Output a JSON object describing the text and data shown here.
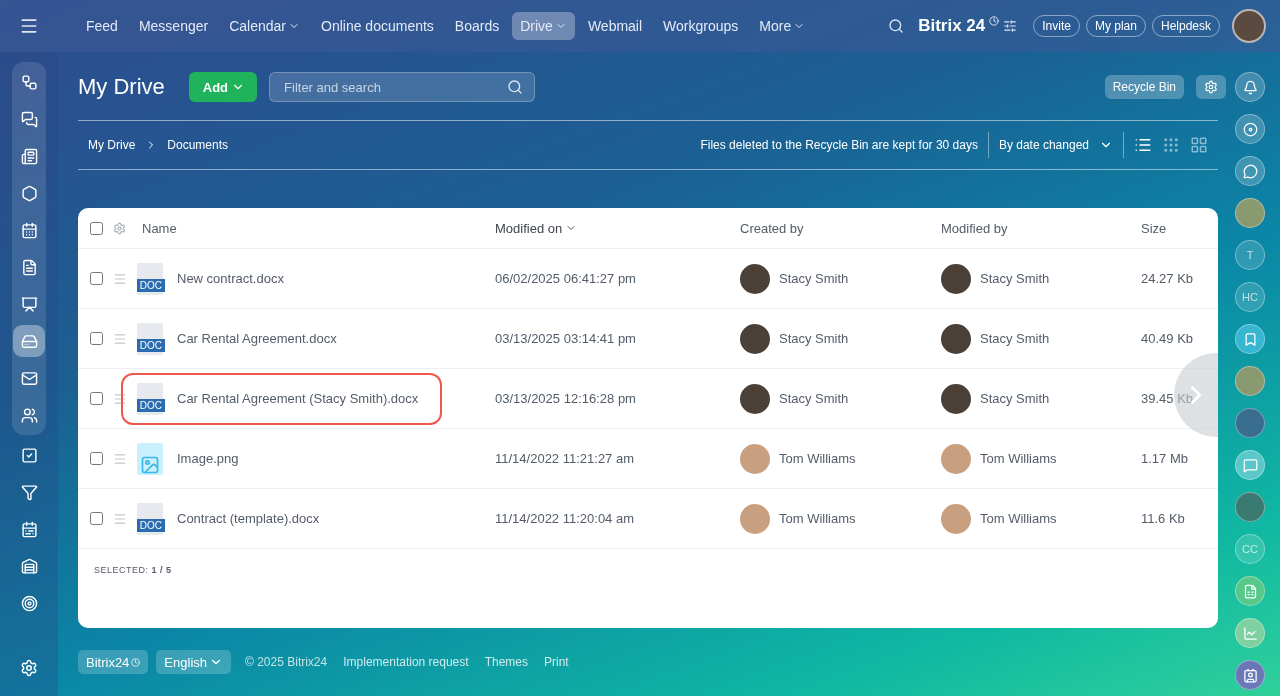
{
  "top_nav": {
    "items": [
      {
        "label": "Feed",
        "dropdown": false,
        "selected": false
      },
      {
        "label": "Messenger",
        "dropdown": false,
        "selected": false
      },
      {
        "label": "Calendar",
        "dropdown": true,
        "selected": false
      },
      {
        "label": "Online documents",
        "dropdown": false,
        "selected": false
      },
      {
        "label": "Boards",
        "dropdown": false,
        "selected": false
      },
      {
        "label": "Drive",
        "dropdown": true,
        "selected": true
      },
      {
        "label": "Webmail",
        "dropdown": false,
        "selected": false
      },
      {
        "label": "Workgroups",
        "dropdown": false,
        "selected": false
      },
      {
        "label": "More",
        "dropdown": true,
        "selected": false
      }
    ],
    "logo": "Bitrix 24",
    "buttons": [
      "Invite",
      "My plan",
      "Helpdesk"
    ]
  },
  "left_sidebar": {
    "items": [
      {
        "selected": false
      },
      {
        "selected": false
      },
      {
        "selected": false
      },
      {
        "selected": false
      },
      {
        "selected": false
      },
      {
        "selected": false
      },
      {
        "selected": false
      },
      {
        "selected": true
      },
      {
        "selected": false
      },
      {
        "selected": false
      },
      {
        "selected": false
      },
      {
        "selected": false
      },
      {
        "selected": false
      },
      {
        "selected": false
      },
      {
        "selected": false
      }
    ]
  },
  "header": {
    "title": "My Drive",
    "add_button": "Add",
    "search": {
      "placeholder": "Filter and search"
    },
    "recycle_bin": "Recycle Bin"
  },
  "breadcrumbs": [
    "My Drive",
    "Documents"
  ],
  "toolbar": {
    "notice": "Files deleted to the Recycle Bin are kept for 30 days",
    "sort": "By date changed",
    "views": [
      {
        "selected": true
      },
      {
        "selected": false
      },
      {
        "selected": false
      }
    ]
  },
  "table": {
    "columns": [
      {
        "label": "Name",
        "sorted": false
      },
      {
        "label": "Modified on",
        "sorted": true
      },
      {
        "label": "Created by",
        "sorted": false
      },
      {
        "label": "Modified by",
        "sorted": false
      },
      {
        "label": "Size",
        "sorted": false
      }
    ],
    "rows": [
      {
        "kind": "doc",
        "badge": "DOC",
        "name": "New contract.docx",
        "modified": "06/02/2025 06:41:27 pm",
        "created_by": "Stacy Smith",
        "modified_by": "Stacy Smith",
        "size": "24.27 Kb",
        "checked": false,
        "highlighted": false
      },
      {
        "kind": "doc",
        "badge": "DOC",
        "name": "Car Rental Agreement.docx",
        "modified": "03/13/2025 03:14:41 pm",
        "created_by": "Stacy Smith",
        "modified_by": "Stacy Smith",
        "size": "40.49 Kb",
        "checked": false,
        "highlighted": false
      },
      {
        "kind": "doc",
        "badge": "DOC",
        "name": "Car Rental Agreement (Stacy Smith).docx",
        "modified": "03/13/2025 12:16:28 pm",
        "created_by": "Stacy Smith",
        "modified_by": "Stacy Smith",
        "size": "39.45 Kb",
        "checked": false,
        "highlighted": true
      },
      {
        "kind": "image",
        "name": "Image.png",
        "modified": "11/14/2022 11:21:27 am",
        "created_by": "Tom Williams",
        "modified_by": "Tom Williams",
        "size": "1.17 Mb",
        "checked": false,
        "highlighted": false
      },
      {
        "kind": "doc",
        "badge": "DOC",
        "name": "Contract (template).docx",
        "modified": "11/14/2022 11:20:04 am",
        "created_by": "Tom Williams",
        "modified_by": "Tom Williams",
        "size": "11.6 Kb",
        "checked": false,
        "highlighted": false
      }
    ],
    "select_all_checked": false,
    "selected_label": "SELECTED:",
    "selected_count": "1 / 5"
  },
  "right_sidebar": {
    "items": [
      {
        "kind": "icon"
      },
      {
        "kind": "icon"
      },
      {
        "kind": "icon"
      },
      {
        "kind": "avatar"
      },
      {
        "kind": "initials",
        "text": "T"
      },
      {
        "kind": "initials",
        "text": "HC"
      },
      {
        "kind": "icon"
      },
      {
        "kind": "avatar"
      },
      {
        "kind": "avatar"
      },
      {
        "kind": "icon"
      },
      {
        "kind": "avatar"
      },
      {
        "kind": "initials",
        "text": "CC"
      },
      {
        "kind": "icon"
      },
      {
        "kind": "icon"
      },
      {
        "kind": "icon"
      }
    ]
  },
  "footer": {
    "brand": "Bitrix24",
    "language": "English",
    "copyright": "© 2025 Bitrix24",
    "links": [
      "Implementation request",
      "Themes",
      "Print"
    ]
  }
}
